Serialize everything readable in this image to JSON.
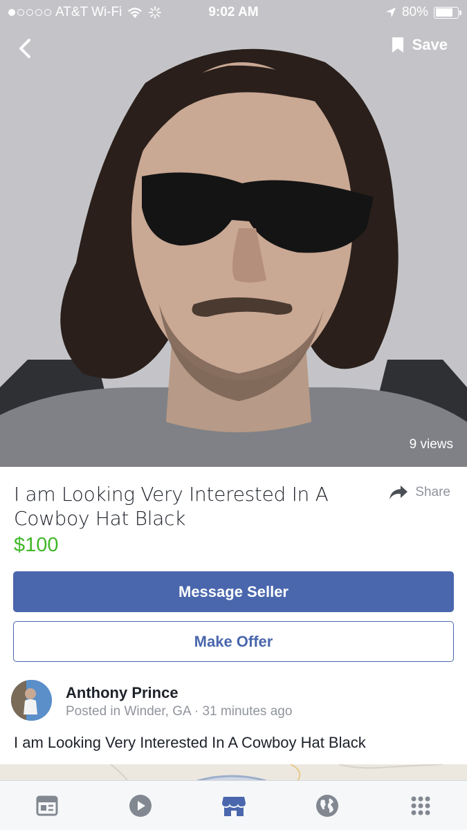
{
  "status_bar": {
    "carrier": "AT&T Wi-Fi",
    "time": "9:02 AM",
    "battery": "80%",
    "battery_level": 0.8
  },
  "header": {
    "save_label": "Save"
  },
  "photo": {
    "views": "9 views"
  },
  "listing": {
    "title": "I am Looking Very Interested In A Cowboy Hat Black",
    "price": "$100",
    "share_label": "Share",
    "message_button": "Message Seller",
    "offer_button": "Make Offer",
    "description": "I am Looking Very Interested In A Cowboy Hat Black"
  },
  "seller": {
    "name": "Anthony Prince",
    "meta": "Posted in Winder, GA · 31 minutes ago"
  },
  "tabs": [
    {
      "icon": "news-feed-icon"
    },
    {
      "icon": "video-icon"
    },
    {
      "icon": "marketplace-icon",
      "active": true
    },
    {
      "icon": "notifications-globe-icon"
    },
    {
      "icon": "menu-grid-icon"
    }
  ],
  "colors": {
    "primary": "#4a67ad",
    "price": "#42b72a",
    "muted": "#90949c",
    "active_tab": "#4a67ad",
    "inactive_tab": "#828891"
  }
}
